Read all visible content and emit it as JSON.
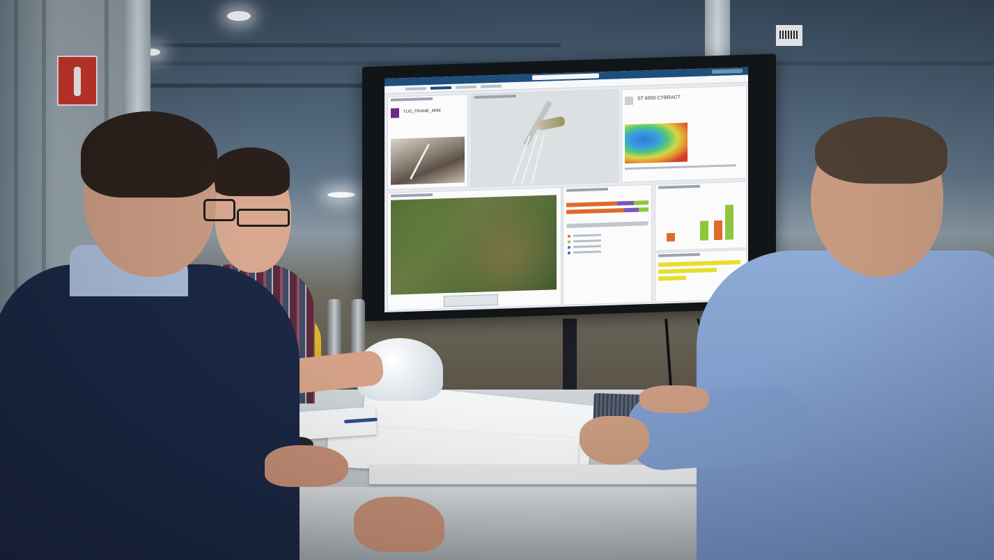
{
  "scene": {
    "type": "photo",
    "subjects": [
      "three-people",
      "wall-monitor",
      "conference-table"
    ]
  },
  "monitor_app": {
    "doc_title": "TUG_FRAME_4898",
    "right_panel_title": "ST 6000 CYBRACT"
  },
  "colors": {
    "topbar": "#1d4f7c",
    "accent_purple": "#6b2d83",
    "bar_orange": "#e06a2b",
    "bar_green": "#8fc63d",
    "bar_purple": "#7a56b8",
    "bar_yellow": "#e7dd2c"
  },
  "icons": {
    "fire_extinguisher_sign": "fire-extinguisher-sign-icon",
    "doc_icon": "document-icon"
  }
}
